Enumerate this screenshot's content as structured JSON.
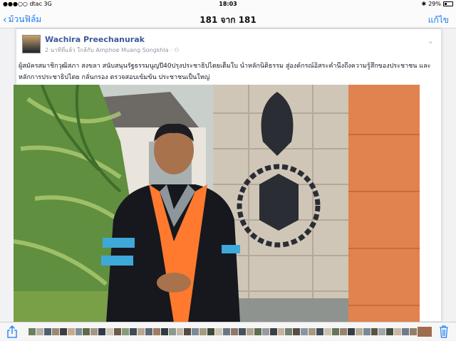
{
  "status_bar": {
    "carrier": "●●●○○ dtac",
    "network": "3G",
    "time": "18:03",
    "battery_percent": "29%",
    "icons": [
      "bluetooth-icon",
      "battery-icon"
    ]
  },
  "nav": {
    "back_label": "ม้วนฟิล์ม",
    "title": "181 จาก 181",
    "edit_label": "แก้ไข"
  },
  "post": {
    "author": "Wachira Preechanurak",
    "meta": "2 นาทีที่แล้ว ใกล้กับ Amphoe Muang Songkhla · ⚇",
    "text": "ผู้สมัครสมาชิกวุฒิสภา สงขลา สนับสนุนรัฐธรรมนูญปี40ปรุงประชาธิปไตยเต็มใบ นำหลักนิติธรรม สู่องค์กรณ์อิสระคำนึงถึงความรู้สึกของประชาชน และหลักการประชาธิปไตย กลั่นกรอง ตรวจสอบเข้มข้น ประชาชนเป็นใหญ่"
  },
  "colors": {
    "accent": "#1a7cf5",
    "author_link": "#3b5998"
  }
}
